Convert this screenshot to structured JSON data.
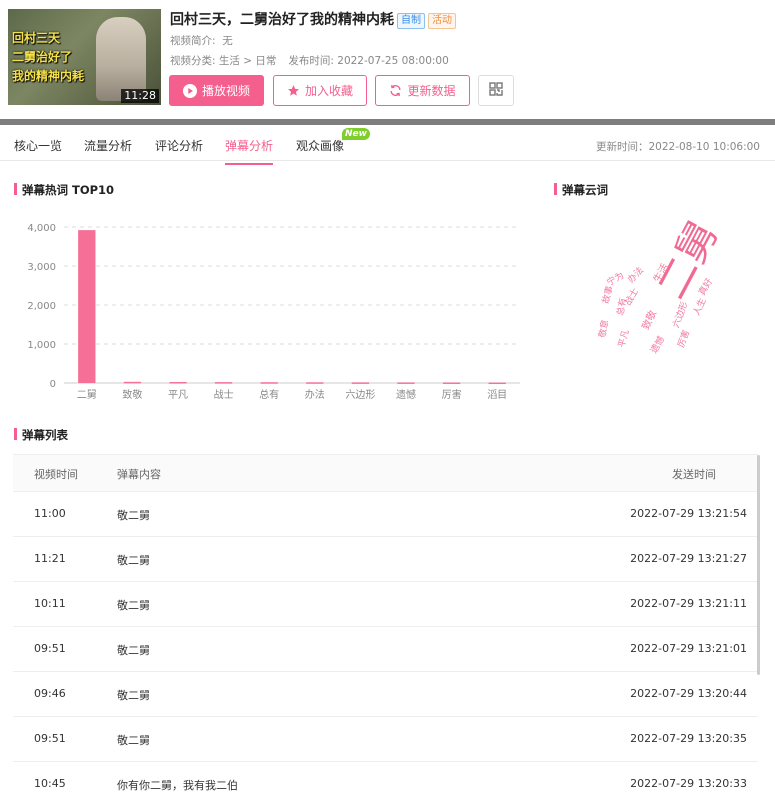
{
  "video": {
    "thumb_lines": [
      "回村三天",
      "二舅治好了",
      "我的精神内耗"
    ],
    "duration": "11:28",
    "title": "回村三天，二舅治好了我的精神内耗",
    "tags": [
      "自制",
      "活动"
    ],
    "intro_label": "视频简介:",
    "intro_value": "无",
    "category_label": "视频分类:",
    "category_value": "生活 > 日常",
    "publish_label": "发布时间:",
    "publish_value": "2022-07-25 08:00:00"
  },
  "actions": {
    "play": "播放视频",
    "favorite": "加入收藏",
    "update": "更新数据"
  },
  "tabs": [
    "核心一览",
    "流量分析",
    "评论分析",
    "弹幕分析",
    "观众画像"
  ],
  "active_tab": 3,
  "new_badge": "New",
  "update_time": "更新时间：2022-08-10 10:06:00",
  "sections": {
    "hotwords": "弹幕热词 TOP10",
    "cloud": "弹幕云词",
    "list": "弹幕列表"
  },
  "chart_data": {
    "type": "bar",
    "title": "弹幕热词 TOP10",
    "categories": [
      "二舅",
      "致敬",
      "平凡",
      "战士",
      "总有",
      "办法",
      "六边形",
      "遗憾",
      "厉害",
      "滔目"
    ],
    "values": [
      3920,
      30,
      25,
      22,
      20,
      18,
      16,
      15,
      14,
      12
    ],
    "ylim": [
      0,
      4000
    ],
    "yticks": [
      "4,000",
      "3,000",
      "2,000",
      "1,000",
      "0"
    ],
    "grid": true,
    "bar_color": "#f56f96"
  },
  "cloud_words": [
    "二舅",
    "生活",
    "宁为",
    "故事",
    "致敬",
    "战士",
    "平凡",
    "六边形",
    "办法",
    "总有",
    "人生",
    "遗憾",
    "厉害",
    "敬意",
    "真好"
  ],
  "danmaku_table": {
    "headers": [
      "视频时间",
      "弹幕内容",
      "发送时间"
    ],
    "rows": [
      [
        "11:00",
        "敬二舅",
        "2022-07-29 13:21:54"
      ],
      [
        "11:21",
        "敬二舅",
        "2022-07-29 13:21:27"
      ],
      [
        "10:11",
        "敬二舅",
        "2022-07-29 13:21:11"
      ],
      [
        "09:51",
        "敬二舅",
        "2022-07-29 13:21:01"
      ],
      [
        "09:46",
        "敬二舅",
        "2022-07-29 13:20:44"
      ],
      [
        "09:51",
        "敬二舅",
        "2022-07-29 13:20:35"
      ],
      [
        "10:45",
        "你有你二舅，我有我二伯",
        "2022-07-29 13:20:33"
      ]
    ]
  }
}
